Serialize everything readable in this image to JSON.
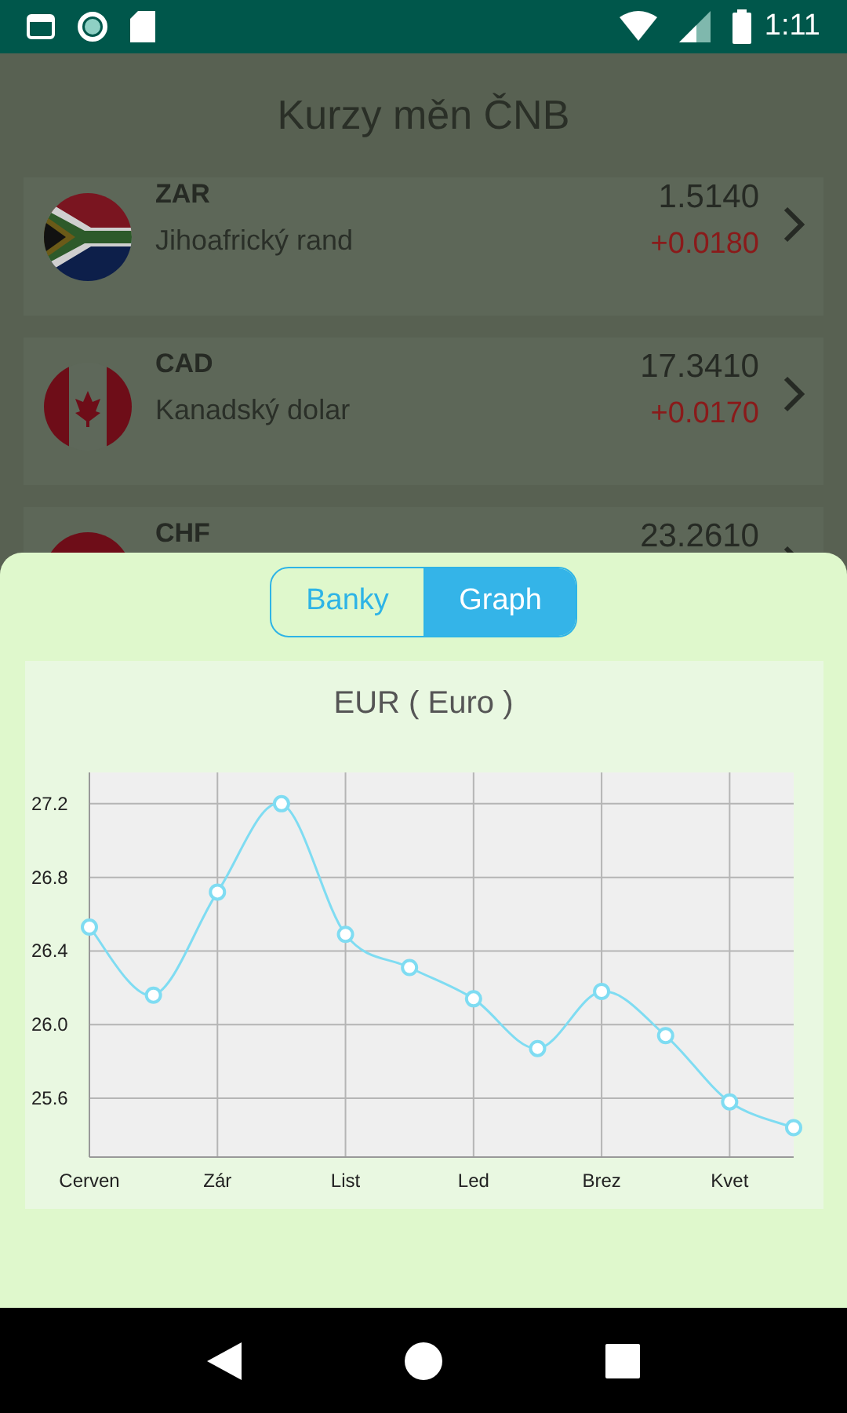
{
  "status_bar": {
    "time": "1:11"
  },
  "title": "Kurzy měn ČNB",
  "rates": [
    {
      "kind": "za",
      "code": "ZAR",
      "name": "Jihoafrický rand",
      "rate": "1.5140",
      "change": "+0.0180"
    },
    {
      "kind": "ca",
      "code": "CAD",
      "name": "Kanadský dolar",
      "rate": "17.3410",
      "change": "+0.0170"
    },
    {
      "kind": "ch",
      "code": "CHF",
      "rate": "23.2610"
    }
  ],
  "sheet": {
    "tabs": [
      {
        "label": "Banky",
        "selected": false
      },
      {
        "label": "Graph",
        "selected": true
      }
    ],
    "chart_data": {
      "type": "line",
      "title": "EUR ( Euro )",
      "categories": [
        "Cerven",
        null,
        "Zár",
        null,
        "List",
        null,
        "Led",
        null,
        "Brez",
        null,
        "Kvet",
        null
      ],
      "grid": true,
      "ylim": [
        25.28,
        27.37
      ],
      "yticks": [
        {
          "value": 25.6,
          "label": "25.6"
        },
        {
          "value": 26.0,
          "label": "26.0"
        },
        {
          "value": 26.4,
          "label": "26.4"
        },
        {
          "value": 26.8,
          "label": "26.8"
        },
        {
          "value": 27.2,
          "label": "27.2"
        }
      ],
      "series": [
        {
          "marker": true,
          "color": "#7fdcf2",
          "values": [
            26.53,
            26.16,
            26.72,
            27.2,
            26.49,
            26.31,
            26.14,
            25.87,
            26.18,
            25.94,
            25.58,
            25.44
          ]
        }
      ]
    }
  }
}
